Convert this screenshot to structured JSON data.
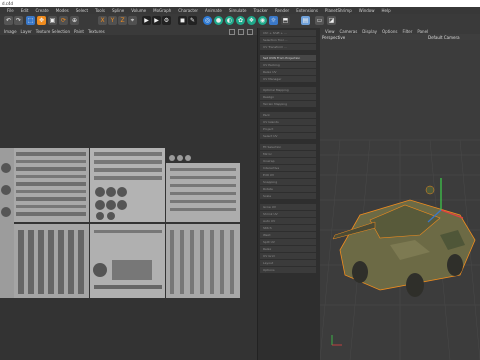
{
  "window": {
    "title": "d.c4d"
  },
  "menubar": [
    "File",
    "Edit",
    "Create",
    "Modes",
    "Select",
    "Tools",
    "Spline",
    "Volume",
    "MoGraph",
    "Character",
    "Animate",
    "Simulate",
    "Tracker",
    "Render",
    "Extensions",
    "PlanetShrimp",
    "Window",
    "Help"
  ],
  "toolbar": {
    "icons": [
      "undo-icon",
      "redo-icon",
      "live-select-icon",
      "move-icon",
      "scale-icon",
      "rotate-icon",
      "transform-icon",
      "x-axis-icon",
      "y-axis-icon",
      "z-axis-icon",
      "world-icon",
      "render-view-icon",
      "render-icon",
      "render-settings-icon",
      "cube-icon",
      "pen-icon",
      "subdivide-icon",
      "cloner-icon",
      "deformer-icon",
      "field-icon",
      "scene-icon",
      "camera-icon",
      "light-icon",
      "tag-icon"
    ],
    "axis_labels": [
      "X",
      "Y",
      "Z"
    ]
  },
  "left_panel": {
    "menu": [
      "Image",
      "Layer",
      "Texture Selection",
      "Paint",
      "Textures"
    ],
    "icons": [
      "fit-icon",
      "grid-icon",
      "settings-icon"
    ]
  },
  "middle_panel": {
    "rows": [
      "Ctrl + Shift + ...",
      "Selection Tool ...",
      "UV Transform ...",
      "Set UVW From Projection",
      "UV Packing",
      "Relax UV",
      "UV Manager",
      "Optimal Mapping",
      "Realign",
      "Terrain Mapping",
      "Pack",
      "UV Islands",
      "Project",
      "Select UV",
      "Fit Selection",
      "Mirror",
      "Unwrap",
      "Interactive",
      "Edit UV",
      "Snapping",
      "Rotate",
      "Scale",
      "Grow UV",
      "Shrink UV",
      "Auto UV",
      "Stitch",
      "Weld",
      "Split UV",
      "Relax",
      "UV Grid",
      "Layout",
      "Options"
    ]
  },
  "viewport": {
    "menu": [
      "View",
      "Cameras",
      "Display",
      "Options",
      "Filter",
      "Panel"
    ],
    "mode": "Perspective",
    "camera": "Default Camera"
  },
  "colors": {
    "accent": "#f08c1e",
    "background": "#2b2b2b",
    "viewport_bg": "#3c3c3c"
  }
}
